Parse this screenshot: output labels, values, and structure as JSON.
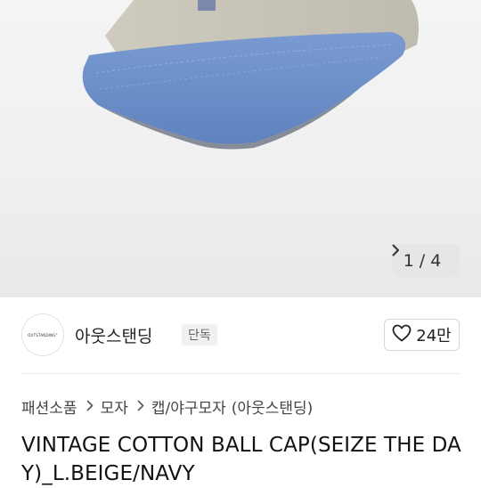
{
  "gallery": {
    "current": "1",
    "separator": "/",
    "total": "4"
  },
  "shop": {
    "logo_text": "OUTSTANDING°",
    "name": "아웃스탠딩",
    "badge": "단독",
    "like_count": "24만"
  },
  "breadcrumb": {
    "items": [
      "패션소품",
      "모자",
      "캡/야구모자"
    ],
    "brand": "(아웃스탠딩)"
  },
  "product": {
    "title": "VINTAGE COTTON BALL CAP(SEIZE THE DAY)_L.BEIGE/NAVY"
  },
  "colors": {
    "cap_crown": "#c7c3b6",
    "cap_brim": "#6f93cc",
    "like_heart": "#222222"
  }
}
